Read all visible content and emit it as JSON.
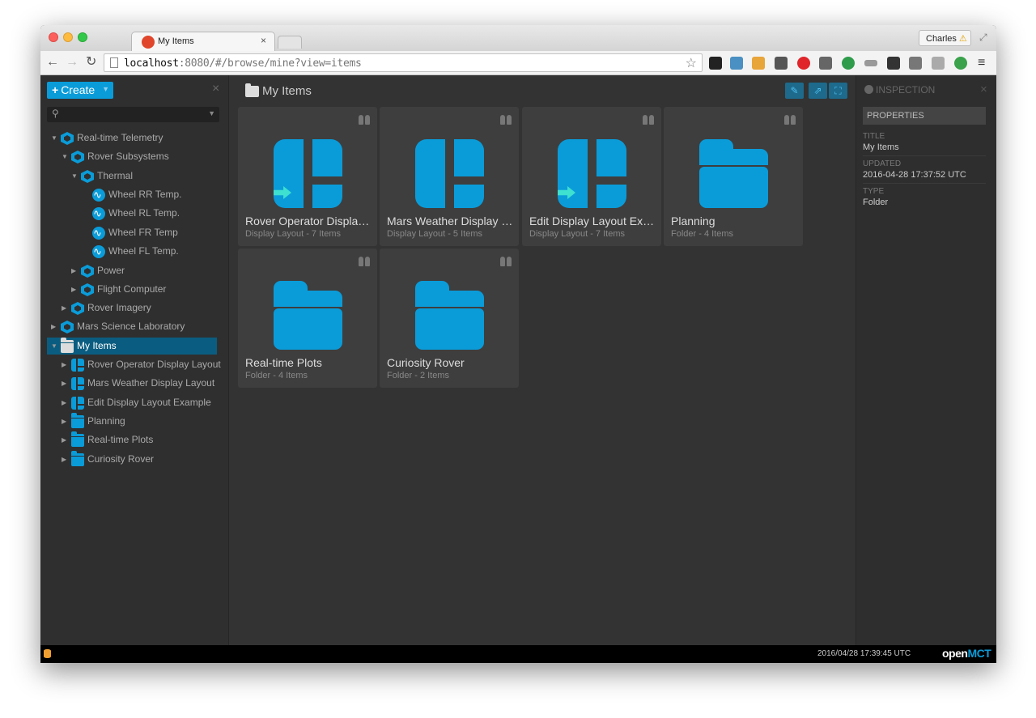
{
  "browser": {
    "tab_title": "My Items",
    "tab_close": "×",
    "profile_name": "Charles",
    "profile_warning": "⚠",
    "url_host": "localhost",
    "url_rest": ":8080/#/browse/mine?view=items"
  },
  "app": {
    "create_label": "Create",
    "tree": [
      {
        "label": "Real-time Telemetry",
        "icon": "telemetry-root-icon"
      },
      {
        "label": "Rover Subsystems",
        "icon": "cube-icon"
      },
      {
        "label": "Thermal",
        "icon": "cube-icon"
      },
      {
        "label": "Wheel RR Temp.",
        "icon": "telemetry-icon"
      },
      {
        "label": "Wheel RL Temp.",
        "icon": "telemetry-icon"
      },
      {
        "label": "Wheel FR Temp",
        "icon": "telemetry-icon"
      },
      {
        "label": "Wheel FL Temp.",
        "icon": "telemetry-icon"
      },
      {
        "label": "Power",
        "icon": "cube-icon"
      },
      {
        "label": "Flight Computer",
        "icon": "cube-icon"
      },
      {
        "label": "Rover Imagery",
        "icon": "cube-icon"
      },
      {
        "label": "Mars Science Laboratory",
        "icon": "cube-icon"
      },
      {
        "label": "My Items",
        "icon": "folder-icon"
      },
      {
        "label": "Rover Operator Display Layout",
        "icon": "layout-icon"
      },
      {
        "label": "Mars Weather Display Layout",
        "icon": "layout-icon"
      },
      {
        "label": "Edit Display Layout Example",
        "icon": "layout-icon"
      },
      {
        "label": "Planning",
        "icon": "folder-icon"
      },
      {
        "label": "Real-time Plots",
        "icon": "folder-icon"
      },
      {
        "label": "Curiosity Rover",
        "icon": "folder-icon"
      }
    ],
    "main_title": "My Items",
    "items": [
      {
        "name": "Rover Operator Display Layout",
        "meta": "Display Layout - 7 Items",
        "type": "layout"
      },
      {
        "name": "Mars Weather Display Layout",
        "meta": "Display Layout - 5 Items",
        "type": "layout"
      },
      {
        "name": "Edit Display Layout Example",
        "meta": "Display Layout - 7 Items",
        "type": "layout"
      },
      {
        "name": "Planning",
        "meta": "Folder - 4 Items",
        "type": "folder"
      },
      {
        "name": "Real-time Plots",
        "meta": "Folder - 4 Items",
        "type": "folder"
      },
      {
        "name": "Curiosity Rover",
        "meta": "Folder - 2 Items",
        "type": "folder"
      }
    ],
    "inspector": {
      "title": "INSPECTION",
      "properties_label": "PROPERTIES",
      "title_label": "TITLE",
      "title_value": "My Items",
      "updated_label": "UPDATED",
      "updated_value": "2016-04-28 17:37:52 UTC",
      "type_label": "TYPE",
      "type_value": "Folder"
    },
    "status": {
      "clock": "2016/04/28 17:39:45 UTC",
      "logo_open": "open",
      "logo_mct": "MCT"
    }
  },
  "colors": {
    "accent": "#0a9cd9",
    "selected_bg": "#0a5d80",
    "arrow_accent": "#3ee0d0"
  }
}
